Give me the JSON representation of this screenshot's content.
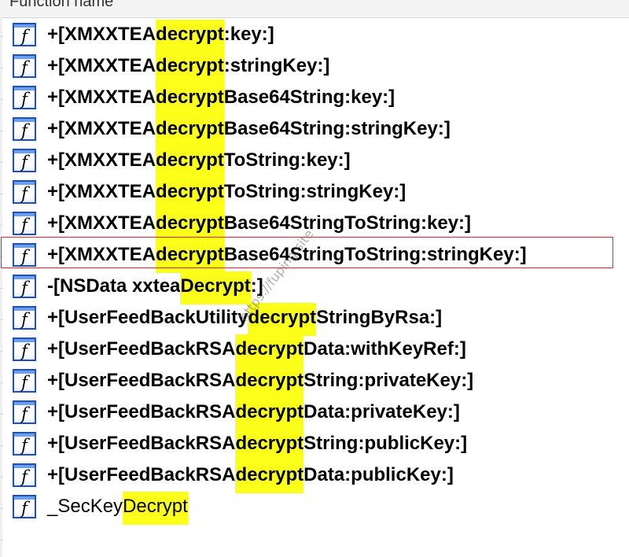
{
  "header": {
    "column_title": "Function name"
  },
  "icon": {
    "glyph": "f",
    "name": "function-icon",
    "border_color": "#1f4fbf"
  },
  "highlight_color": "#fcff1a",
  "selection_color": "#e5262d",
  "selected_index": 7,
  "watermark": "https://fuping.site",
  "rows": [
    {
      "pre": "+[XMXXTEA ",
      "hl": "decrypt",
      "post": ":key:]"
    },
    {
      "pre": "+[XMXXTEA ",
      "hl": "decrypt",
      "post": ":stringKey:]"
    },
    {
      "pre": "+[XMXXTEA ",
      "hl": "decrypt",
      "post": "Base64String:key:]"
    },
    {
      "pre": "+[XMXXTEA ",
      "hl": "decrypt",
      "post": "Base64String:stringKey:]"
    },
    {
      "pre": "+[XMXXTEA ",
      "hl": "decrypt",
      "post": "ToString:key:]"
    },
    {
      "pre": "+[XMXXTEA ",
      "hl": "decrypt",
      "post": "ToString:stringKey:]"
    },
    {
      "pre": "+[XMXXTEA ",
      "hl": "decrypt",
      "post": "Base64StringToString:key:]"
    },
    {
      "pre": "+[XMXXTEA ",
      "hl": "decrypt",
      "post": "Base64StringToString:stringKey:]"
    },
    {
      "pre": "-[NSData xxtea",
      "hl": "Decrypt",
      "post": ":]"
    },
    {
      "pre": "+[UserFeedBackUtility ",
      "hl": "decrypt",
      "post": "StringByRsa:]"
    },
    {
      "pre": "+[UserFeedBackRSA ",
      "hl": "decrypt",
      "post": "Data:withKeyRef:]"
    },
    {
      "pre": "+[UserFeedBackRSA ",
      "hl": "decrypt",
      "post": "String:privateKey:]"
    },
    {
      "pre": "+[UserFeedBackRSA ",
      "hl": "decrypt",
      "post": "Data:privateKey:]"
    },
    {
      "pre": "+[UserFeedBackRSA ",
      "hl": "decrypt",
      "post": "String:publicKey:]"
    },
    {
      "pre": "+[UserFeedBackRSA ",
      "hl": "decrypt",
      "post": "Data:publicKey:]"
    },
    {
      "pre": "_SecKey",
      "hl": "Decrypt",
      "post": "",
      "plain": true
    }
  ]
}
